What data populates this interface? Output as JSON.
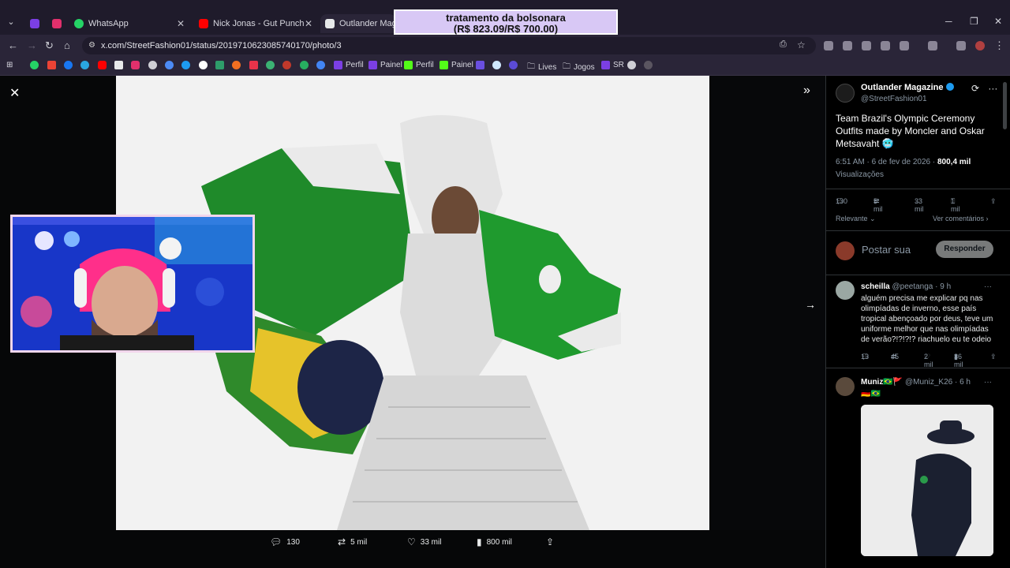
{
  "browser": {
    "tabs": [
      {
        "label": "",
        "favicon_color": "#7b3fe4"
      },
      {
        "label": "",
        "favicon_color": "#e1306c"
      },
      {
        "label": "WhatsApp",
        "favicon_color": "#25d366"
      },
      {
        "label": "Nick Jonas - Gut Punch - YouTube",
        "favicon_color": "#ff0000"
      },
      {
        "label": "Outlander Magazine",
        "favicon_color": "#e7e9ea"
      }
    ],
    "url": "x.com/StreetFashion01/status/2019710623085740170/photo/3",
    "bookmarks": [
      {
        "label": "Perfil",
        "color": "#7b3fe4"
      },
      {
        "label": "Painel",
        "color": "#7b3fe4"
      },
      {
        "label": "Perfil",
        "color": "#53fc18"
      },
      {
        "label": "Painel",
        "color": "#53fc18"
      },
      {
        "label": "Lives",
        "color": "#cfcfd6"
      },
      {
        "label": "Jogos",
        "color": "#cfcfd6"
      },
      {
        "label": "SR",
        "color": "#7b3fe4"
      }
    ]
  },
  "overlay_banner": {
    "line1": "tratamento da bolsonara",
    "line2": "(R$ 823.09/R$ 700.00)"
  },
  "viewer": {
    "actions": {
      "replies": "130",
      "reposts": "5 mil",
      "likes": "33 mil",
      "views": "800 mil"
    }
  },
  "sidebar": {
    "author_name": "Outlander Magazine",
    "author_handle": "@StreetFashion01",
    "post_text": "Team Brazil's Olympic Ceremony Outfits made by Moncler and Oskar Metsavaht 🥶",
    "timestamp": "6:51 AM · 6 de fev de 2026 ·",
    "views_count": "800,4 mil",
    "views_label": "Visualizações",
    "stats": {
      "replies": "130",
      "reposts": "5 mil",
      "likes": "33 mil",
      "bookmarks": "1 mil"
    },
    "sort_label": "Relevante",
    "see_comments": "Ver comentários",
    "reply_placeholder": "Postar sua",
    "reply_button": "Responder",
    "comments": [
      {
        "name": "scheilla",
        "handle": "@peetanga · 9 h",
        "text": "alguém precisa me explicar pq nas olimpíadas de inverno, esse país tropical abençoado por deus, teve um uniforme melhor que nas olimpíadas de verão?!?!?!? riachuelo eu te odeio",
        "replies": "13",
        "reposts": "45",
        "likes": "2 mil",
        "views": "36 mil"
      },
      {
        "name": "Muniz🇧🇷🚩",
        "handle": "@Muniz_K26 · 6 h",
        "text": "🇩🇪🇧🇷"
      }
    ]
  }
}
